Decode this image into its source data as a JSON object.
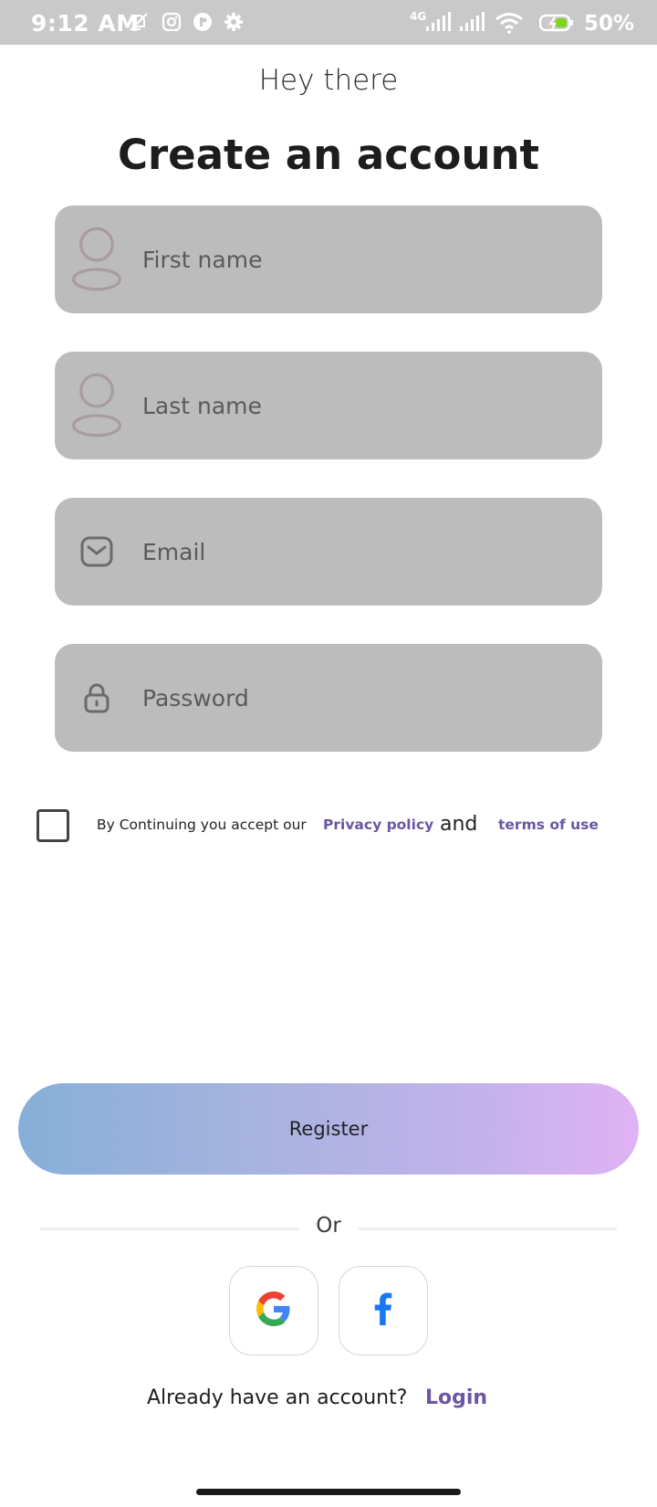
{
  "status_bar": {
    "time": "9:12 AM",
    "network_label": "4G",
    "battery_percent": "50%",
    "icons": [
      "bell-off-icon",
      "instagram-icon",
      "app-icon",
      "settings-gear-icon",
      "signal-icon",
      "signal-icon",
      "wifi-icon",
      "battery-charging-icon"
    ]
  },
  "header": {
    "greeting": "Hey there",
    "title": "Create an account"
  },
  "form": {
    "first_name": {
      "placeholder": "First name",
      "value": "",
      "icon": "person-icon"
    },
    "last_name": {
      "placeholder": "Last name",
      "value": "",
      "icon": "person-icon"
    },
    "email": {
      "placeholder": "Email",
      "value": "",
      "icon": "mail-icon"
    },
    "password": {
      "placeholder": "Password",
      "value": "",
      "icon": "lock-icon"
    }
  },
  "terms": {
    "checked": false,
    "prefix": "By Continuing you accept our",
    "privacy_label": "Privacy policy",
    "and_label": "and",
    "terms_label": "terms of use"
  },
  "register": {
    "label": "Register"
  },
  "divider": {
    "label": "Or"
  },
  "social": {
    "google_icon": "google-icon",
    "facebook_icon": "facebook-icon"
  },
  "footer": {
    "prompt": "Already have an account?",
    "login_label": "Login"
  },
  "colors": {
    "field_bg": "#bcbcbc",
    "link": "#6b56a3",
    "status_bar": "#c9c9c9",
    "gradient_start": "#86afd8",
    "gradient_end": "#e0b2f4"
  }
}
